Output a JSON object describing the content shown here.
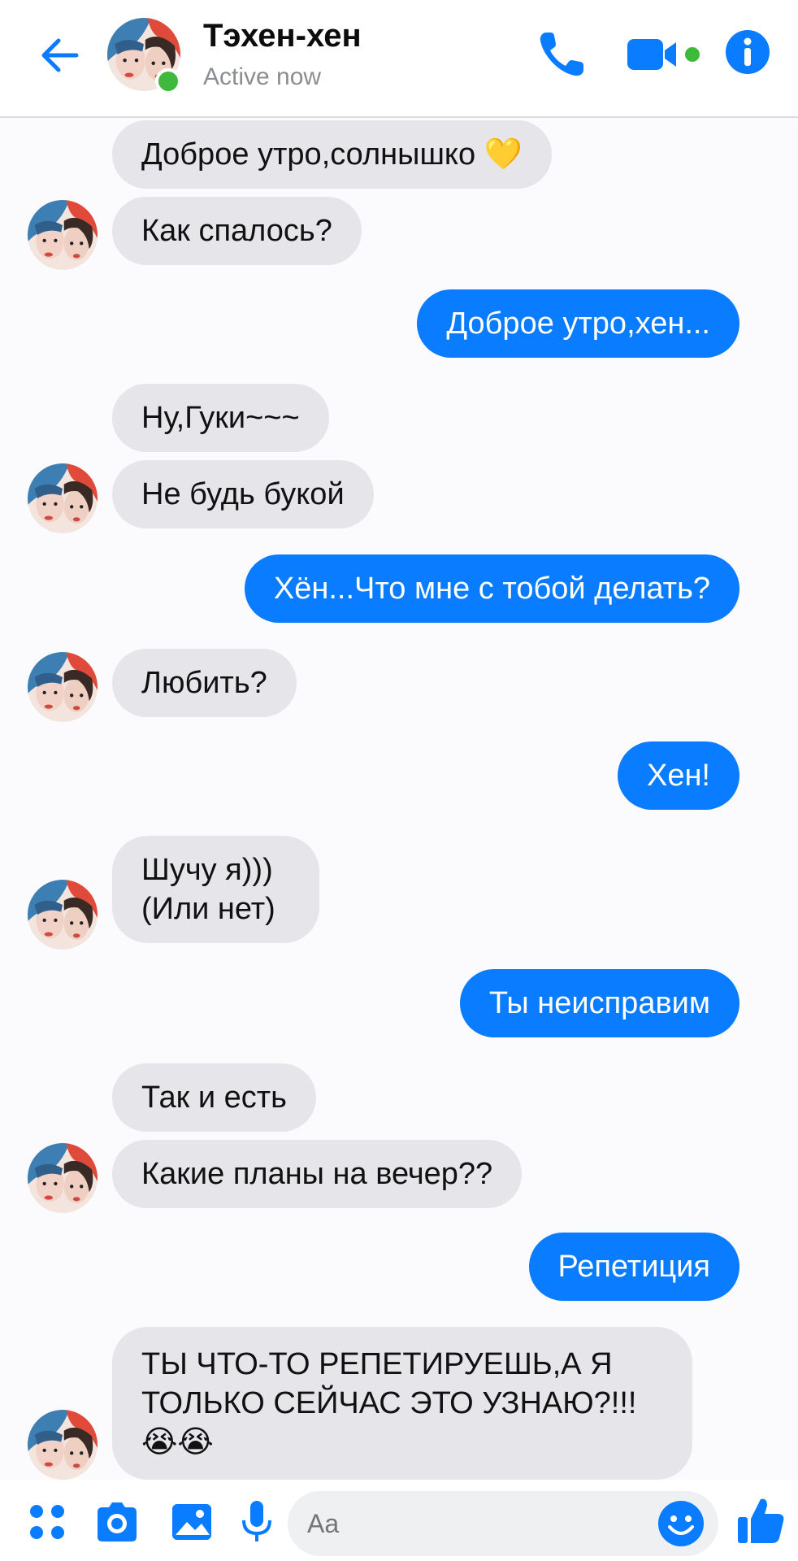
{
  "header": {
    "contact_name": "Тэхен-хен",
    "status": "Active now"
  },
  "messages": [
    {
      "side": "in",
      "text": "Доброе утро,солнышко 💛"
    },
    {
      "side": "in",
      "text": "Как спалось?"
    },
    {
      "side": "out",
      "text": "Доброе утро,хен..."
    },
    {
      "side": "in",
      "text": "Ну,Гуки~~~"
    },
    {
      "side": "in",
      "text": "Не будь букой"
    },
    {
      "side": "out",
      "text": "Хён...Что мне с тобой делать?"
    },
    {
      "side": "in",
      "text": "Любить?"
    },
    {
      "side": "out",
      "text": "Хен!"
    },
    {
      "side": "in",
      "lines": [
        "Шучу я)))",
        "(Или нет)"
      ]
    },
    {
      "side": "out",
      "text": "Ты неисправим"
    },
    {
      "side": "in",
      "text": "Так и есть"
    },
    {
      "side": "in",
      "text": "Какие планы на вечер??"
    },
    {
      "side": "out",
      "text": "Репетиция"
    },
    {
      "side": "in",
      "lines": [
        "ТЫ ЧТО-ТО РЕПЕТИРУЕШЬ,А Я",
        "ТОЛЬКО СЕЙЧАС ЭТО УЗНАЮ?!!!",
        "😭😭"
      ]
    }
  ],
  "composer": {
    "placeholder": "Aa"
  },
  "colors": {
    "accent": "#0a7cff",
    "incoming_bubble": "#e5e5ea",
    "online": "#3fb93b"
  },
  "icons": [
    "back-arrow-icon",
    "phone-icon",
    "video-camera-icon",
    "info-icon",
    "apps-grid-icon",
    "camera-icon",
    "image-icon",
    "microphone-icon",
    "emoji-icon",
    "thumbs-up-icon"
  ]
}
